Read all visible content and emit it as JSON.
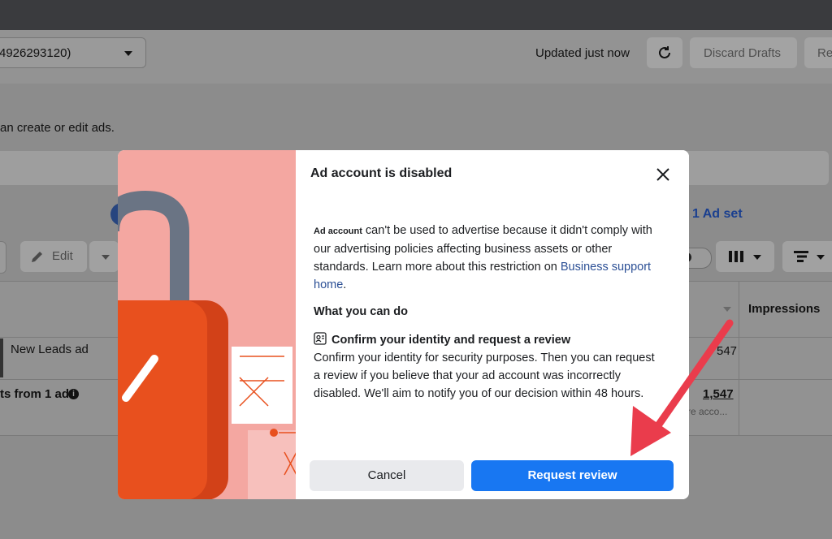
{
  "toolbar": {
    "account_select": "4926293120)",
    "updated": "Updated just now",
    "discard_label": "Discard Drafts",
    "re_label": "Re"
  },
  "page": {
    "notice": "an create or edit ads.",
    "adset_link": "1 Ad set",
    "edit_label": "Edit"
  },
  "table": {
    "impressions_header": "Impressions",
    "ad_name": "New Leads ad",
    "row1_value": "547",
    "results_label": "ts from 1 ad",
    "total_value": "1,547",
    "total_sub": "re acco..."
  },
  "modal": {
    "title": "Ad account is disabled",
    "body_prefix": "Ad account",
    "body_text": " can't be used to advertise because it didn't comply with our advertising policies affecting business assets or other standards. Learn more about this restriction on ",
    "body_link": "Business support home",
    "body_suffix": ".",
    "what_heading": "What you can do",
    "confirm_heading": "Confirm your identity and request a review",
    "confirm_body": "Confirm your identity for security purposes. Then you can request a review if you believe that your ad account was incorrectly disabled. We'll aim to notify you of our decision within 48 hours.",
    "cancel_label": "Cancel",
    "review_label": "Request review"
  },
  "colors": {
    "primary_button": "#1877f2",
    "link": "#2b4f95",
    "arrow": "#ea3c4c",
    "lock_body": "#e8501e",
    "illustration_bg": "#f4a7a1"
  },
  "icons": [
    "refresh-icon",
    "pencil-icon",
    "columns-icon",
    "breakdown-icon",
    "info-icon",
    "close-icon",
    "id-card-icon",
    "lock-illustration",
    "red-arrow-annotation"
  ]
}
